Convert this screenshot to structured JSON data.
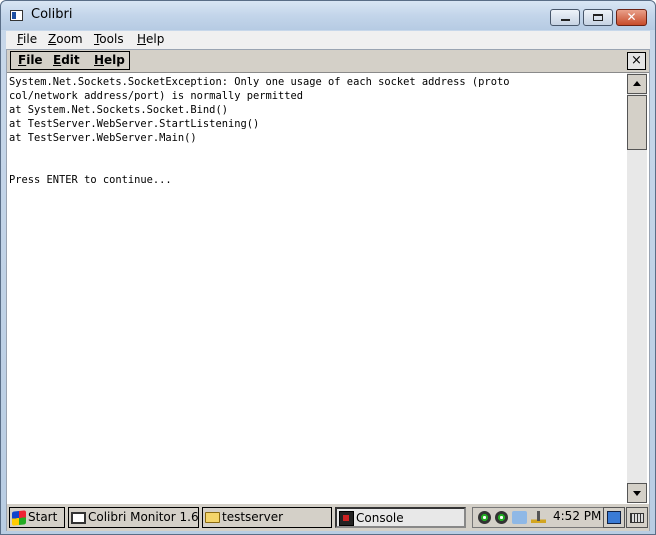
{
  "window": {
    "title": "Colibri",
    "menu": [
      {
        "label_u": "F",
        "label_rest": "ile"
      },
      {
        "label_u": "Z",
        "label_rest": "oom"
      },
      {
        "label_u": "T",
        "label_rest": "ools"
      },
      {
        "label_u": "H",
        "label_rest": "elp"
      }
    ]
  },
  "app": {
    "menu": [
      {
        "label_u": "F",
        "label_rest": "ile"
      },
      {
        "label_u": "E",
        "label_rest": "dit"
      },
      {
        "label_u": "H",
        "label_rest": "elp"
      }
    ],
    "close_label": "×"
  },
  "console": {
    "text": "System.Net.Sockets.SocketException: Only one usage of each socket address (proto\ncol/network address/port) is normally permitted\nat System.Net.Sockets.Socket.Bind()\nat TestServer.WebServer.StartListening()\nat TestServer.WebServer.Main()\n\n\nPress ENTER to continue..."
  },
  "taskbar": {
    "start_label": "Start",
    "tasks": [
      {
        "label": "Colibri Monitor 1.6",
        "icon": "monitor-icon"
      },
      {
        "label": "testserver",
        "icon": "folder-icon"
      },
      {
        "label": "Console",
        "icon": "console-icon",
        "active": true
      }
    ],
    "clock": "4:52 PM"
  }
}
